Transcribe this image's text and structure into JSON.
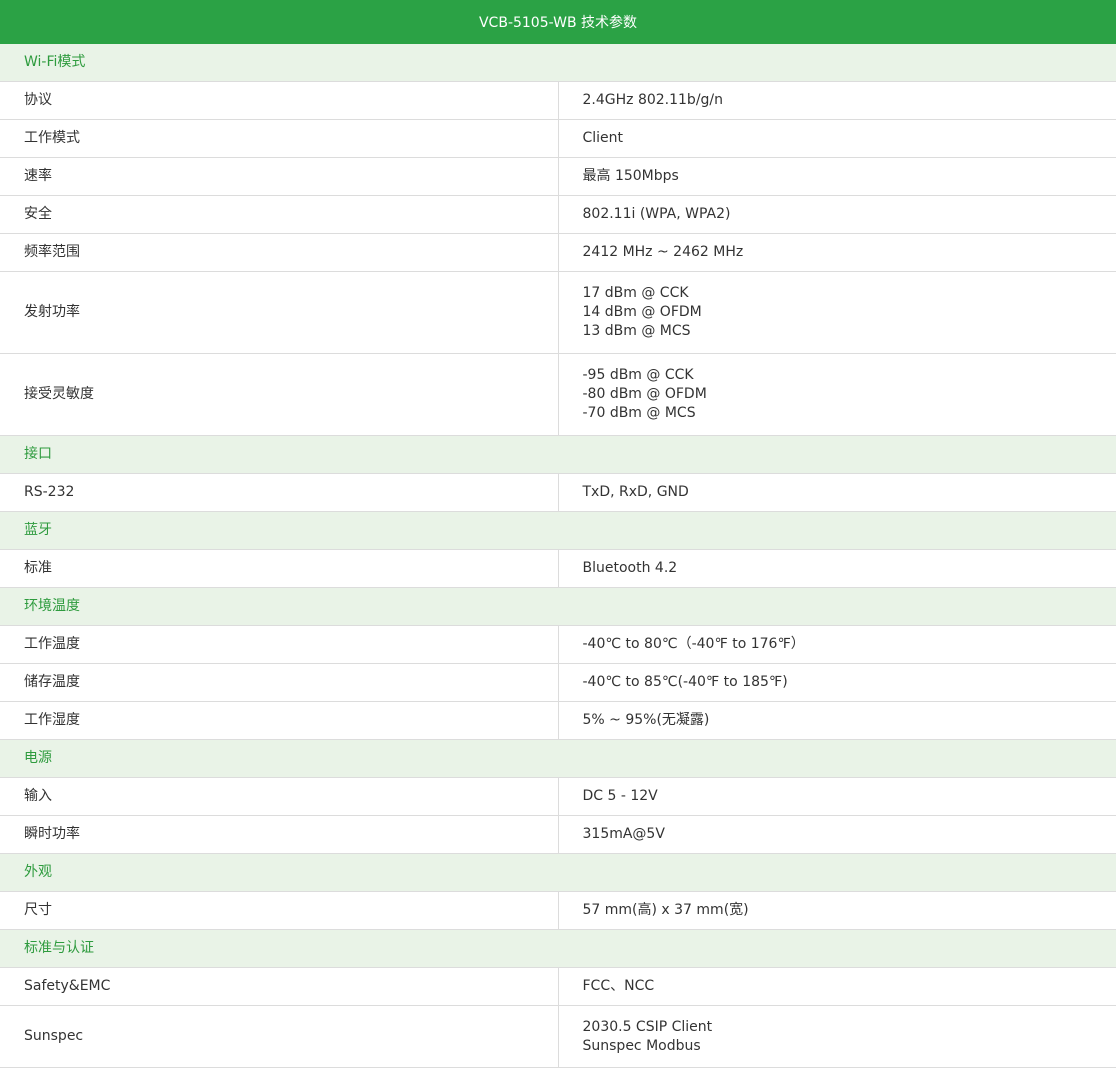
{
  "title": "VCB-5105-WB 技术参数",
  "sections": [
    {
      "heading": "Wi-Fi模式",
      "rows": [
        {
          "label": "协议",
          "lines": [
            "2.4GHz 802.11b/g/n"
          ]
        },
        {
          "label": "工作模式",
          "lines": [
            "Client"
          ]
        },
        {
          "label": "速率",
          "lines": [
            "最高 150Mbps"
          ]
        },
        {
          "label": "安全",
          "lines": [
            "802.11i (WPA, WPA2)"
          ]
        },
        {
          "label": "频率范围",
          "lines": [
            "2412 MHz ~ 2462 MHz"
          ]
        },
        {
          "label": "发射功率",
          "lines": [
            "17 dBm @ CCK",
            "14 dBm @ OFDM",
            "13 dBm @ MCS"
          ]
        },
        {
          "label": "接受灵敏度",
          "lines": [
            "-95 dBm @ CCK",
            "-80 dBm @ OFDM",
            "-70 dBm @ MCS"
          ]
        }
      ]
    },
    {
      "heading": "接口",
      "rows": [
        {
          "label": "RS-232",
          "lines": [
            "TxD, RxD, GND"
          ]
        }
      ]
    },
    {
      "heading": "蓝牙",
      "rows": [
        {
          "label": "标准",
          "lines": [
            "Bluetooth 4.2"
          ]
        }
      ]
    },
    {
      "heading": "环境温度",
      "rows": [
        {
          "label": "工作温度",
          "lines": [
            "-40℃ to 80℃（-40℉ to 176℉）"
          ]
        },
        {
          "label": "储存温度",
          "lines": [
            "-40℃ to 85℃(-40℉ to 185℉)"
          ]
        },
        {
          "label": "工作湿度",
          "lines": [
            "5% ~ 95%(无凝露)"
          ]
        }
      ]
    },
    {
      "heading": "电源",
      "rows": [
        {
          "label": "输入",
          "lines": [
            "DC 5 - 12V"
          ]
        },
        {
          "label": "瞬时功率",
          "lines": [
            "315mA@5V"
          ]
        }
      ]
    },
    {
      "heading": "外观",
      "rows": [
        {
          "label": "尺寸",
          "lines": [
            "57 mm(高) x 37 mm(宽)"
          ]
        }
      ]
    },
    {
      "heading": "标准与认证",
      "rows": [
        {
          "label": "Safety&EMC",
          "lines": [
            "FCC、NCC"
          ]
        },
        {
          "label": "Sunspec",
          "lines": [
            "2030.5 CSIP Client",
            "Sunspec Modbus"
          ]
        }
      ]
    }
  ]
}
